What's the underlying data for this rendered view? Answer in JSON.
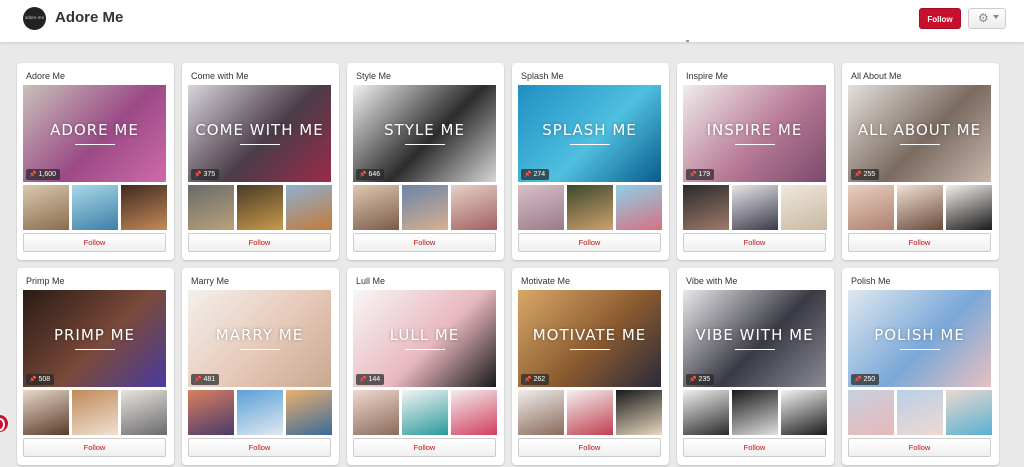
{
  "header": {
    "title": "Adore Me",
    "avatar_text": "adore me",
    "follow_label": "Follow",
    "settings_icon": "gear-icon"
  },
  "boards": [
    {
      "title": "Adore Me",
      "cover_label": "ADORE ME",
      "pins": "1,600",
      "follow": "Follow",
      "cover_colors": [
        "#c8c0b8",
        "#9a4a86",
        "#d06aaa"
      ],
      "thumb_colors": [
        [
          "#d9c9b0",
          "#8a6c4c"
        ],
        [
          "#a8d8e8",
          "#3d7fa8"
        ],
        [
          "#3f2a20",
          "#c48a5a"
        ]
      ]
    },
    {
      "title": "Come with Me",
      "cover_label": "COME WITH ME",
      "pins": "375",
      "follow": "Follow",
      "cover_colors": [
        "#d8d4dc",
        "#4a3c48",
        "#9c2a4a"
      ],
      "thumb_colors": [
        [
          "#6a6a6a",
          "#b9a27a"
        ],
        [
          "#4b3b2a",
          "#c89a4a"
        ],
        [
          "#8fb0d0",
          "#c27a3a"
        ]
      ]
    },
    {
      "title": "Style Me",
      "cover_label": "STYLE ME",
      "pins": "646",
      "follow": "Follow",
      "cover_colors": [
        "#f2f2f2",
        "#2c2c2c",
        "#d7d7d7"
      ],
      "thumb_colors": [
        [
          "#e0c9b0",
          "#7a5a4a"
        ],
        [
          "#6a84a8",
          "#d8b090"
        ],
        [
          "#e8d0c8",
          "#a06060"
        ]
      ]
    },
    {
      "title": "Splash Me",
      "cover_label": "SPLASH ME",
      "pins": "274",
      "follow": "Follow",
      "cover_colors": [
        "#1e8fc2",
        "#4fc0e0",
        "#0a5a8a"
      ],
      "thumb_colors": [
        [
          "#d8c0c8",
          "#9a7a8a"
        ],
        [
          "#3a4a2a",
          "#d0a070"
        ],
        [
          "#8cd0e8",
          "#d87080"
        ]
      ]
    },
    {
      "title": "Inspire Me",
      "cover_label": "INSPIRE ME",
      "pins": "179",
      "follow": "Follow",
      "cover_colors": [
        "#f0ecec",
        "#b87a96",
        "#7a4a6a"
      ],
      "thumb_colors": [
        [
          "#2a2a2a",
          "#a07a6a"
        ],
        [
          "#e8e4e8",
          "#3a3a4a"
        ],
        [
          "#f0e8dc",
          "#c8b8a0"
        ]
      ]
    },
    {
      "title": "All About Me",
      "cover_label": "ALL ABOUT ME",
      "pins": "255",
      "follow": "Follow",
      "cover_colors": [
        "#e4e0dc",
        "#7a6a60",
        "#c8b8ac"
      ],
      "thumb_colors": [
        [
          "#e8d0c0",
          "#b08070"
        ],
        [
          "#f0e0d4",
          "#6a4a3a"
        ],
        [
          "#f4f0ec",
          "#1a1a1a"
        ]
      ]
    },
    {
      "title": "Primp Me",
      "cover_label": "PRIMP ME",
      "pins": "508",
      "follow": "Follow",
      "cover_colors": [
        "#2a1a14",
        "#7a4a3a",
        "#4a3aa0"
      ],
      "thumb_colors": [
        [
          "#e8d8c8",
          "#5a3a2a"
        ],
        [
          "#c08a5a",
          "#f0e0d0"
        ],
        [
          "#e8e4e0",
          "#6a6a6a"
        ]
      ]
    },
    {
      "title": "Marry Me",
      "cover_label": "MARRY ME",
      "pins": "481",
      "follow": "Follow",
      "cover_colors": [
        "#f4f0ec",
        "#e6c8b8",
        "#c8a890"
      ],
      "thumb_colors": [
        [
          "#d88060",
          "#4a3a6a"
        ],
        [
          "#5aa0d8",
          "#e0e8f0"
        ],
        [
          "#e8b070",
          "#3a6a9a"
        ]
      ]
    },
    {
      "title": "Lull Me",
      "cover_label": "LULL ME",
      "pins": "144",
      "follow": "Follow",
      "cover_colors": [
        "#f8f6f6",
        "#e8b8c0",
        "#1a1a1a"
      ],
      "thumb_colors": [
        [
          "#f0d8d0",
          "#8a6a5a"
        ],
        [
          "#f4f4f4",
          "#2a9a9a"
        ],
        [
          "#f4ecec",
          "#d04060"
        ]
      ]
    },
    {
      "title": "Motivate Me",
      "cover_label": "MOTIVATE ME",
      "pins": "262",
      "follow": "Follow",
      "cover_colors": [
        "#d8a868",
        "#8a5a30",
        "#2a2a3a"
      ],
      "thumb_colors": [
        [
          "#f0ecec",
          "#8a6a5a"
        ],
        [
          "#f4f0f0",
          "#c04050"
        ],
        [
          "#1a1a1a",
          "#e8d8c0"
        ]
      ]
    },
    {
      "title": "Vibe with Me",
      "cover_label": "VIBE WITH ME",
      "pins": "235",
      "follow": "Follow",
      "cover_colors": [
        "#e8e8ec",
        "#3a3a44",
        "#8a8a94"
      ],
      "thumb_colors": [
        [
          "#f0f0f0",
          "#2a2a2a"
        ],
        [
          "#1a1a1a",
          "#e0e0e0"
        ],
        [
          "#f4f4f4",
          "#1a1a1a"
        ]
      ]
    },
    {
      "title": "Polish Me",
      "cover_label": "POLISH ME",
      "pins": "250",
      "follow": "Follow",
      "cover_colors": [
        "#dfe8f0",
        "#7aa8d8",
        "#e8c0c0"
      ],
      "thumb_colors": [
        [
          "#c8d0e0",
          "#e8b8b8"
        ],
        [
          "#b8d0e8",
          "#f0d8d0"
        ],
        [
          "#e8d8d0",
          "#5ab0d0"
        ]
      ]
    }
  ]
}
